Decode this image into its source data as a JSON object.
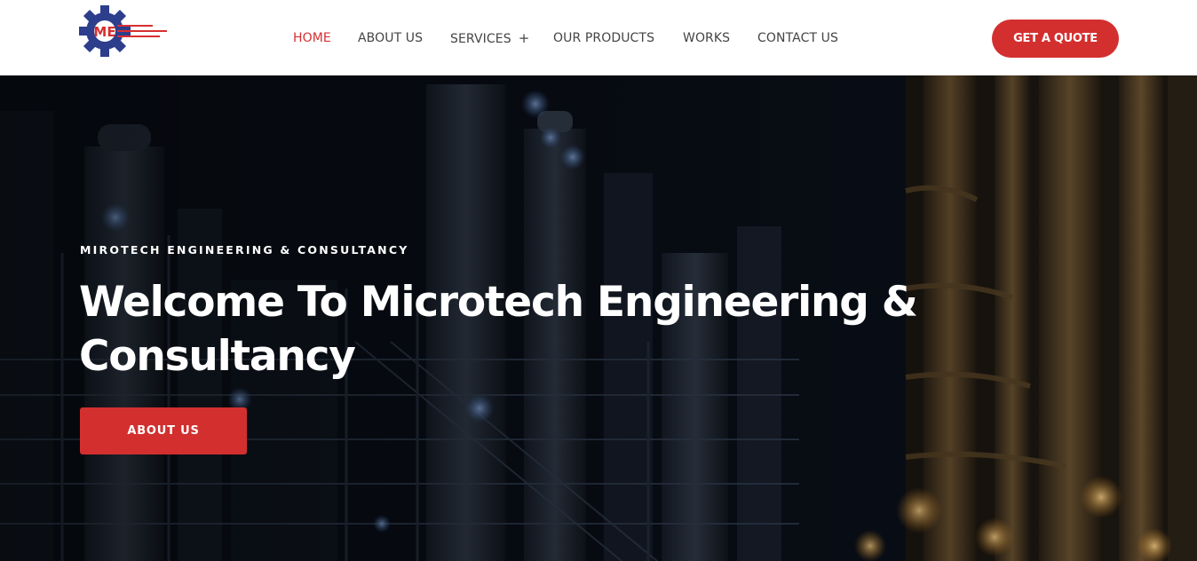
{
  "header": {
    "logo_icon": "gear-logo-icon",
    "logo_text": "ME",
    "nav": [
      {
        "label": "HOME",
        "active": true
      },
      {
        "label": "ABOUT US",
        "active": false
      },
      {
        "label": "SERVICES",
        "active": false,
        "has_submenu": true,
        "submenu_icon": "+"
      },
      {
        "label": "OUR PRODUCTS",
        "active": false
      },
      {
        "label": "WORKS",
        "active": false
      },
      {
        "label": "CONTACT US",
        "active": false
      }
    ],
    "quote_button": "GET A QUOTE"
  },
  "hero": {
    "eyebrow": "MIROTECH ENGINEERING & CONSULTANCY",
    "title_line1": "Welcome To Microtech Engineering &",
    "title_line2": "Consultancy",
    "button": "ABOUT US",
    "background_image": "industrial-refinery-night-image"
  },
  "colors": {
    "accent": "#d32f2f",
    "nav_active": "#d63031",
    "nav_text": "#444444",
    "logo_blue": "#2c3e8c"
  }
}
